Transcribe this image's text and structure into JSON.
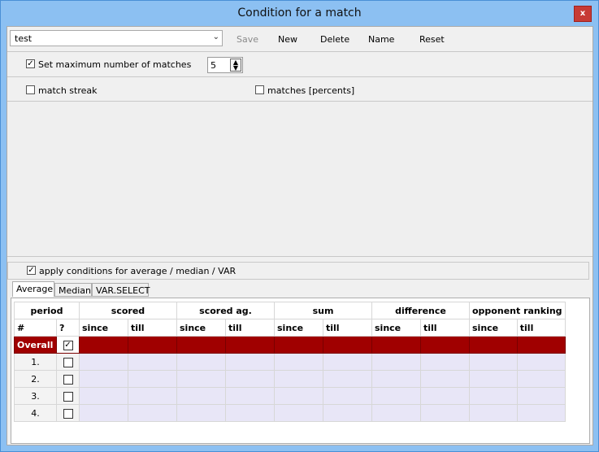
{
  "window": {
    "title": "Condition for a match",
    "close_glyph": "x"
  },
  "toolbar": {
    "profile_value": "test",
    "save": "Save",
    "new": "New",
    "delete": "Delete",
    "name": "Name",
    "reset": "Reset"
  },
  "options": {
    "max_matches_label": "Set maximum number of matches",
    "max_matches_checked": true,
    "max_matches_value": "5",
    "match_streak_label": "match streak",
    "matches_percents_label": "matches [percents]",
    "apply_label": "apply conditions for average / median / VAR"
  },
  "tabs": [
    "Average",
    "Median",
    "VAR.SELECT"
  ],
  "grid": {
    "groups": [
      "period",
      "scored",
      "scored ag.",
      "sum",
      "difference",
      "opponent ranking"
    ],
    "subheaders": [
      "#",
      "?",
      "since",
      "till",
      "since",
      "till",
      "since",
      "till",
      "since",
      "till",
      "since",
      "till"
    ],
    "overall_label": "Overall",
    "rows": [
      "1.",
      "2.",
      "3.",
      "4."
    ]
  },
  "colors": {
    "overall_row": "#a00000",
    "data_row": "#e8e6f7"
  }
}
